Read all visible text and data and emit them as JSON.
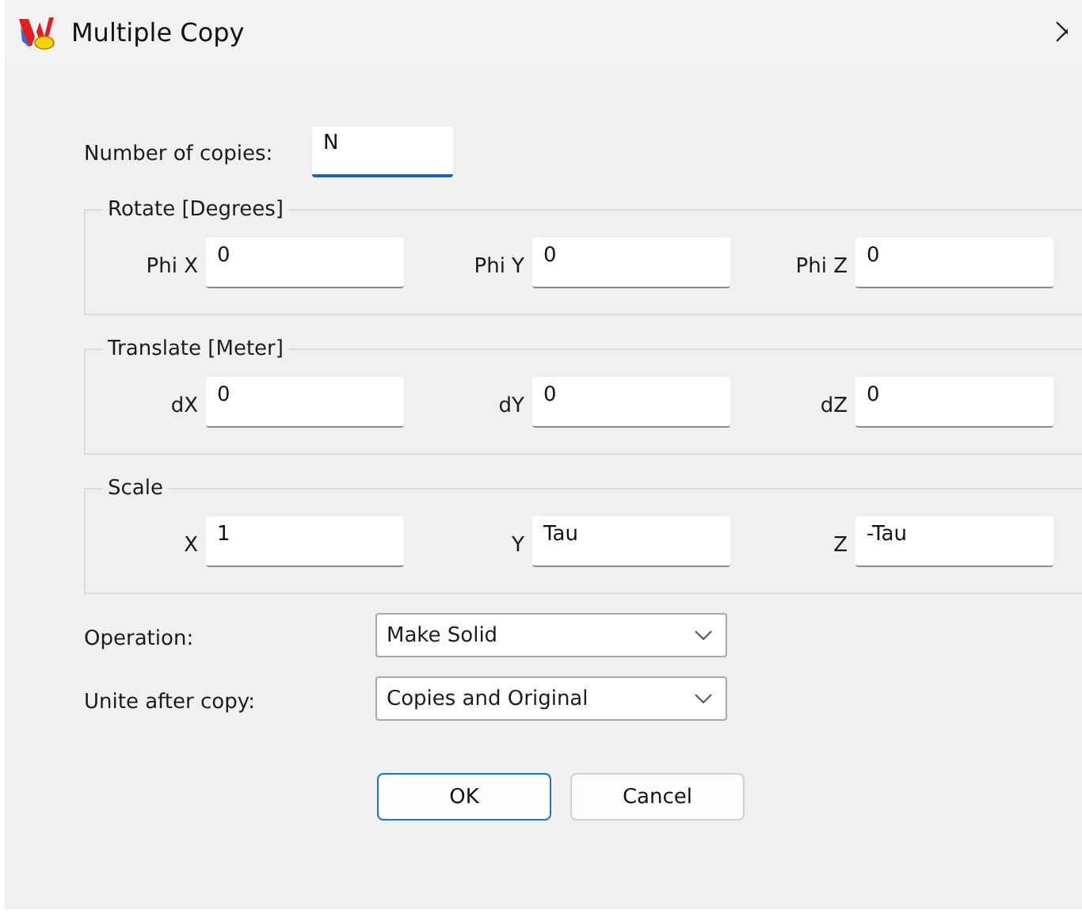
{
  "window": {
    "title": "Multiple Copy"
  },
  "number_of_copies": {
    "label": "Number of copies:",
    "value": "N",
    "focused": true
  },
  "groups": [
    {
      "title": "Rotate [Degrees]",
      "fields": [
        {
          "label": "Phi X",
          "value": "0"
        },
        {
          "label": "Phi Y",
          "value": "0"
        },
        {
          "label": "Phi Z",
          "value": "0"
        }
      ]
    },
    {
      "title": "Translate [Meter]",
      "fields": [
        {
          "label": "dX",
          "value": "0"
        },
        {
          "label": "dY",
          "value": "0"
        },
        {
          "label": "dZ",
          "value": "0"
        }
      ]
    },
    {
      "title": "Scale",
      "fields": [
        {
          "label": "X",
          "value": "1"
        },
        {
          "label": "Y",
          "value": "Tau"
        },
        {
          "label": "Z",
          "value": "-Tau"
        }
      ]
    }
  ],
  "dropdowns": [
    {
      "label": "Operation:",
      "value": "Make Solid"
    },
    {
      "label": "Unite after copy:",
      "value": "Copies and Original"
    }
  ],
  "buttons": [
    {
      "label": "OK",
      "default": true
    },
    {
      "label": "Cancel",
      "default": false
    }
  ]
}
